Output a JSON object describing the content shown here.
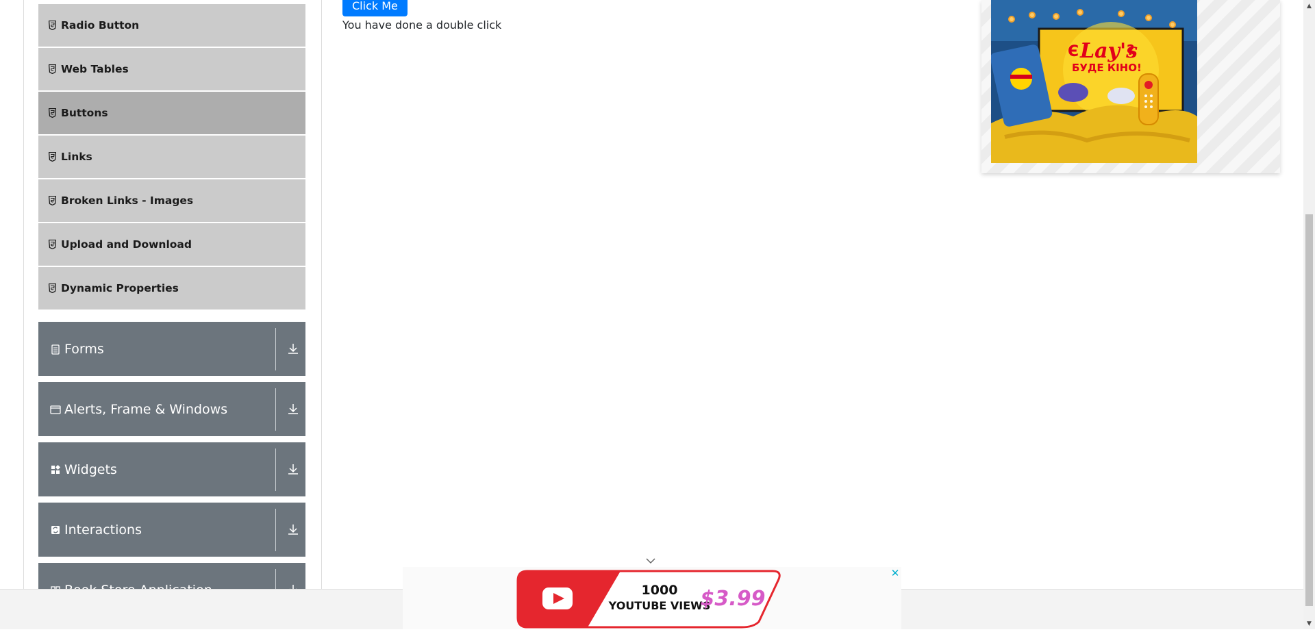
{
  "sidebar": {
    "elements_items": [
      {
        "label": "Radio Button",
        "icon": "html5-icon"
      },
      {
        "label": "Web Tables",
        "icon": "html5-icon"
      },
      {
        "label": "Buttons",
        "icon": "html5-icon",
        "active": true
      },
      {
        "label": "Links",
        "icon": "html5-icon"
      },
      {
        "label": "Broken Links - Images",
        "icon": "html5-icon"
      },
      {
        "label": "Upload and Download",
        "icon": "html5-icon"
      },
      {
        "label": "Dynamic Properties",
        "icon": "html5-icon"
      }
    ],
    "groups": [
      {
        "label": "Forms",
        "icon": "form-icon"
      },
      {
        "label": "Alerts, Frame & Windows",
        "icon": "window-icon"
      },
      {
        "label": "Widgets",
        "icon": "widgets-icon"
      },
      {
        "label": "Interactions",
        "icon": "interactions-icon"
      },
      {
        "label": "Book Store Application",
        "icon": "book-icon"
      }
    ]
  },
  "main": {
    "click_button_label": "Click Me",
    "double_click_message": "You have done a double click"
  },
  "ads": {
    "top_right": {
      "brand": "Lay's",
      "headline_1": "Є",
      "headline_2": "?",
      "headline_3": "БУДЕ КІНО!"
    },
    "bottom_banner": {
      "line1": "1000",
      "line2": "YOUTUBE VIEWS",
      "price": "$3.99"
    }
  },
  "colors": {
    "group_bg": "#6c757d",
    "sub_item_bg": "#cbcbcb",
    "sub_item_active_bg": "#adadad",
    "primary": "#007bff"
  }
}
